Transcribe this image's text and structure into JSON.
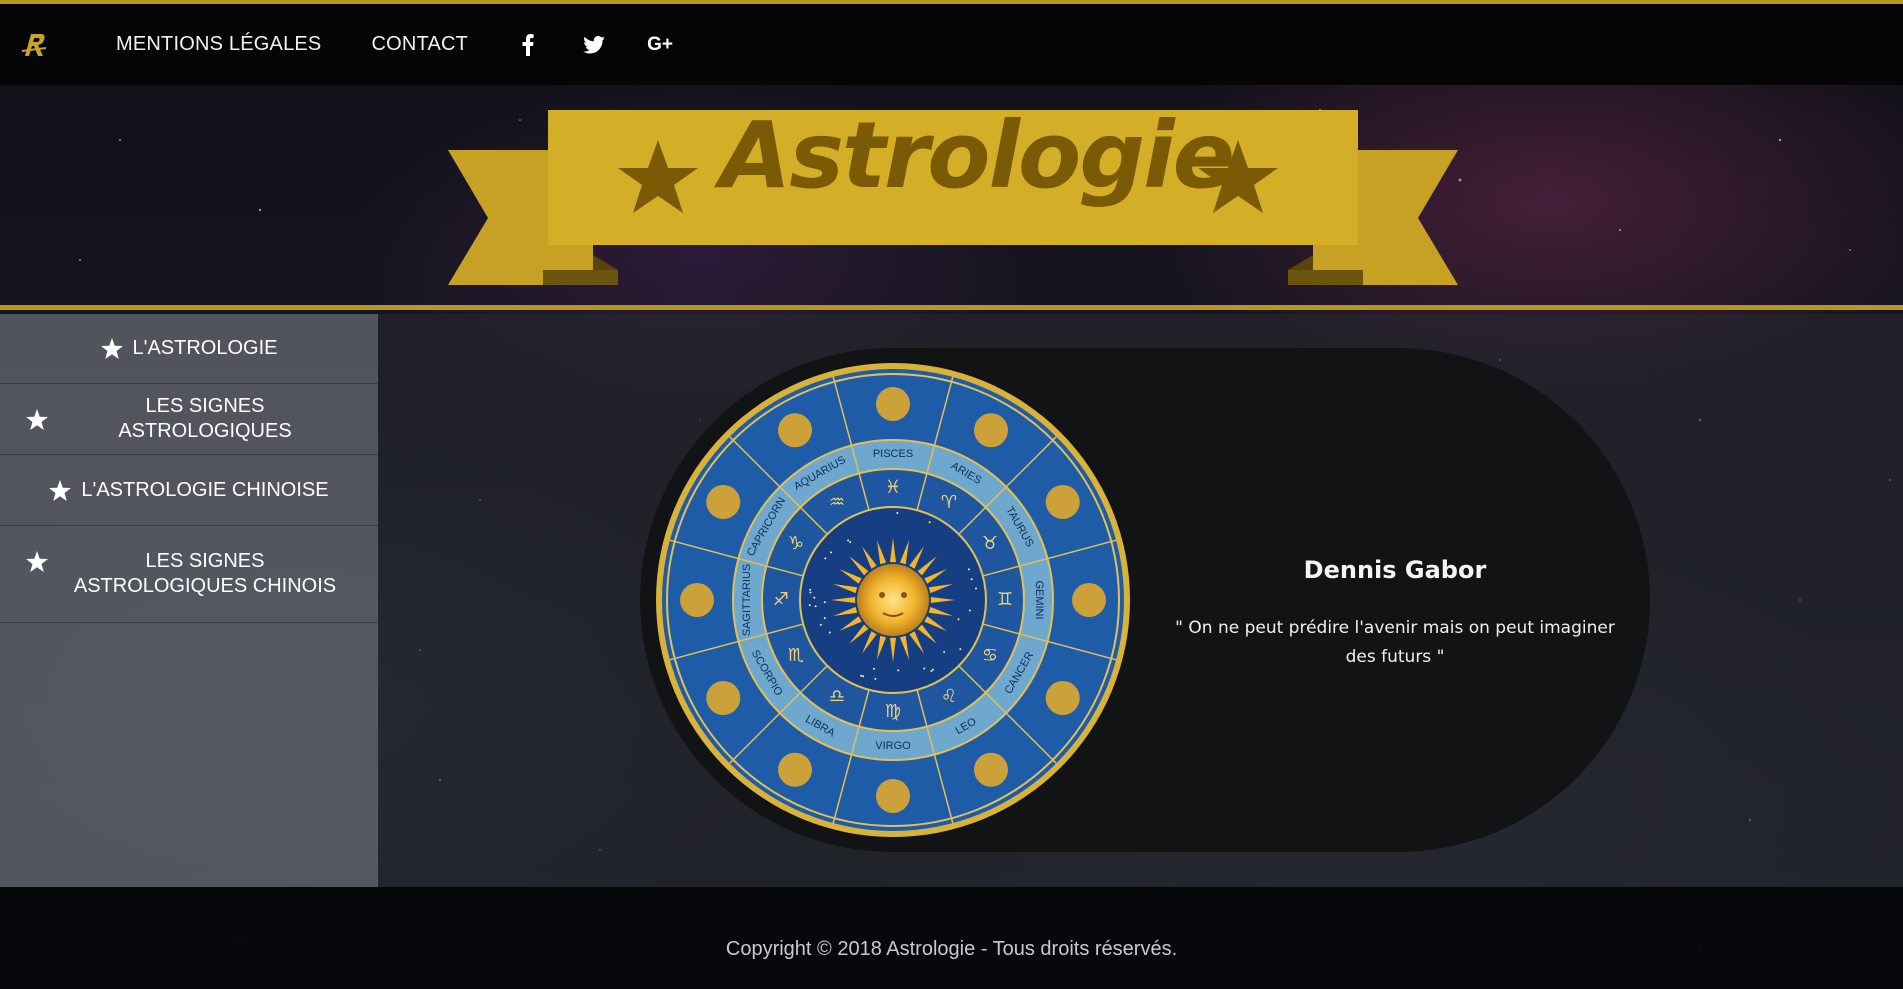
{
  "colors": {
    "gold": "#b8961c",
    "banner_gold": "#d5ae28",
    "banner_text": "#7a5a05",
    "wheel_blue": "#1f5ca8"
  },
  "nav": {
    "logo_icon": "astrology-logo-icon",
    "links": [
      "MENTIONS LÉGALES",
      "CONTACT"
    ],
    "social": [
      "facebook-icon",
      "twitter-icon",
      "google-plus-icon"
    ],
    "gplus_label": "G+"
  },
  "banner": {
    "title": "Astrologie"
  },
  "sidebar": {
    "items": [
      {
        "label": "L'ASTROLOGIE"
      },
      {
        "label": "LES SIGNES ASTROLOGIQUES"
      },
      {
        "label": "L'ASTROLOGIE CHINOISE"
      },
      {
        "label": "LES SIGNES ASTROLOGIQUES CHINOIS"
      }
    ]
  },
  "main": {
    "wheel_signs": [
      "PISCES",
      "ARIES",
      "TAURUS",
      "GEMINI",
      "CANCER",
      "LEO",
      "VIRGO",
      "LIBRA",
      "SCORPIO",
      "SAGITTARIUS",
      "CAPRICORN",
      "AQUARIUS"
    ],
    "author": "Dennis Gabor",
    "quote": "\" On ne peut prédire l'avenir mais on peut imaginer des futurs \""
  },
  "footer": {
    "copyright": "Copyright © 2018 Astrologie - Tous droits réservés."
  }
}
